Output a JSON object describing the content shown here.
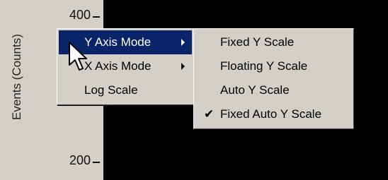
{
  "chart": {
    "ylabel": "Events (Counts)",
    "ticks": [
      {
        "label": "400"
      },
      {
        "label": "200"
      }
    ]
  },
  "context_menu": {
    "items": [
      {
        "label": "Y Axis Mode",
        "highlighted": true,
        "has_submenu": true
      },
      {
        "label": "X Axis Mode",
        "highlighted": false,
        "has_submenu": true
      },
      {
        "label": "Log Scale",
        "highlighted": false,
        "has_submenu": false
      }
    ]
  },
  "submenu": {
    "items": [
      {
        "label": "Fixed Y Scale",
        "checked": false
      },
      {
        "label": "Floating Y Scale",
        "checked": false
      },
      {
        "label": "Auto Y Scale",
        "checked": false
      },
      {
        "label": "Fixed Auto Y Scale",
        "checked": true
      }
    ]
  },
  "icons": {
    "check": "✔"
  },
  "colors": {
    "menu_bg": "#d4d0c8",
    "highlight": "#0a246a",
    "plot_bg": "#000000"
  }
}
